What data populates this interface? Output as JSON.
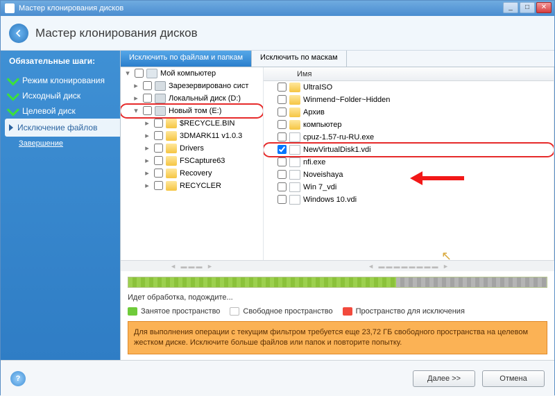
{
  "window": {
    "title": "Мастер клонирования дисков"
  },
  "header": {
    "title": "Мастер клонирования дисков"
  },
  "sidebar": {
    "heading": "Обязательные шаги:",
    "steps": [
      {
        "label": "Режим клонирования",
        "state": "done"
      },
      {
        "label": "Исходный диск",
        "state": "done"
      },
      {
        "label": "Целевой диск",
        "state": "done"
      },
      {
        "label": "Исключение файлов",
        "state": "current"
      },
      {
        "label": "Завершение",
        "state": "plain"
      }
    ]
  },
  "tabs": {
    "files": "Исключить по файлам и папкам",
    "masks": "Исключить по маскам"
  },
  "tree": {
    "root": "Мой компьютер",
    "nodes": [
      {
        "label": "Зарезервировано сист",
        "icon": "drv",
        "indent": 1
      },
      {
        "label": "Локальный диск (D:)",
        "icon": "drv",
        "indent": 1
      },
      {
        "label": "Новый том (E:)",
        "icon": "drv",
        "indent": 1,
        "expanded": true,
        "highlight": true
      },
      {
        "label": "$RECYCLE.BIN",
        "icon": "fold",
        "indent": 2
      },
      {
        "label": "3DMARK11 v1.0.3",
        "icon": "fold",
        "indent": 2
      },
      {
        "label": "Drivers",
        "icon": "fold",
        "indent": 2
      },
      {
        "label": "FSCapture63",
        "icon": "fold",
        "indent": 2
      },
      {
        "label": "Recovery",
        "icon": "fold",
        "indent": 2
      },
      {
        "label": "RECYCLER",
        "icon": "fold",
        "indent": 2
      }
    ]
  },
  "list": {
    "header": "Имя",
    "items": [
      {
        "label": "UltraISO",
        "icon": "fold"
      },
      {
        "label": "Winmend~Folder~Hidden",
        "icon": "fold"
      },
      {
        "label": "Архив",
        "icon": "fold"
      },
      {
        "label": "компьютер",
        "icon": "fold"
      },
      {
        "label": "cpuz-1.57-ru-RU.exe",
        "icon": "file"
      },
      {
        "label": "NewVirtualDisk1.vdi",
        "icon": "file",
        "checked": true,
        "highlight": true
      },
      {
        "label": "nfi.exe",
        "icon": "file"
      },
      {
        "label": "Noveishaya",
        "icon": "file"
      },
      {
        "label": "Win 7_vdi",
        "icon": "file"
      },
      {
        "label": "Windows 10.vdi",
        "icon": "file"
      }
    ]
  },
  "status": {
    "text": "Идет обработка, подождите..."
  },
  "legend": {
    "used": "Занятое пространство",
    "free": "Свободное пространство",
    "excl": "Пространство для исключения"
  },
  "warning": "Для выполнения операции с текущим фильтром требуется еще 23,72 ГБ свободного пространства на целевом жестком диске. Исключите больше файлов или папок и повторите попытку.",
  "footer": {
    "next": "Далее >>",
    "cancel": "Отмена"
  }
}
